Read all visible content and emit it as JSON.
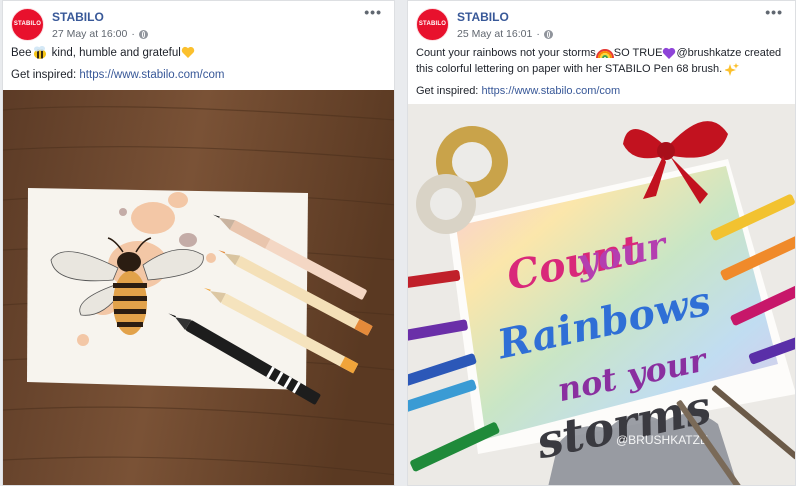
{
  "posts": [
    {
      "page_name": "STABILO",
      "avatar_text": "STABILO",
      "timestamp": "27 May at 16:00",
      "caption_parts": [
        "Bee",
        " kind, humble and grateful"
      ],
      "inspire_label": "Get inspired:",
      "link": "https://www.stabilo.com/com",
      "icons": [
        "bee-emoji-icon",
        "yellow-heart-emoji-icon",
        "globe-icon",
        "more-options-icon"
      ]
    },
    {
      "page_name": "STABILO",
      "avatar_text": "STABILO",
      "timestamp": "25 May at 16:01",
      "caption_line1_parts": [
        "Count your rainbows not your storms",
        "SO TRUE",
        "@brushkatze created"
      ],
      "caption_line2": "this colorful lettering on paper with her STABILO Pen 68 brush.",
      "inspire_label": "Get inspired:",
      "link": "https://www.stabilo.com/com",
      "photo_lettering": [
        "Count",
        "your",
        "Rainbows",
        "not your",
        "storms"
      ],
      "photo_watermark": "@BRUSHKATZE",
      "icons": [
        "rainbow-emoji-icon",
        "purple-heart-emoji-icon",
        "sparkles-emoji-icon",
        "globe-icon",
        "more-options-icon"
      ]
    }
  ],
  "colors": {
    "brand_red": "#e8112d",
    "link_blue": "#385898"
  }
}
